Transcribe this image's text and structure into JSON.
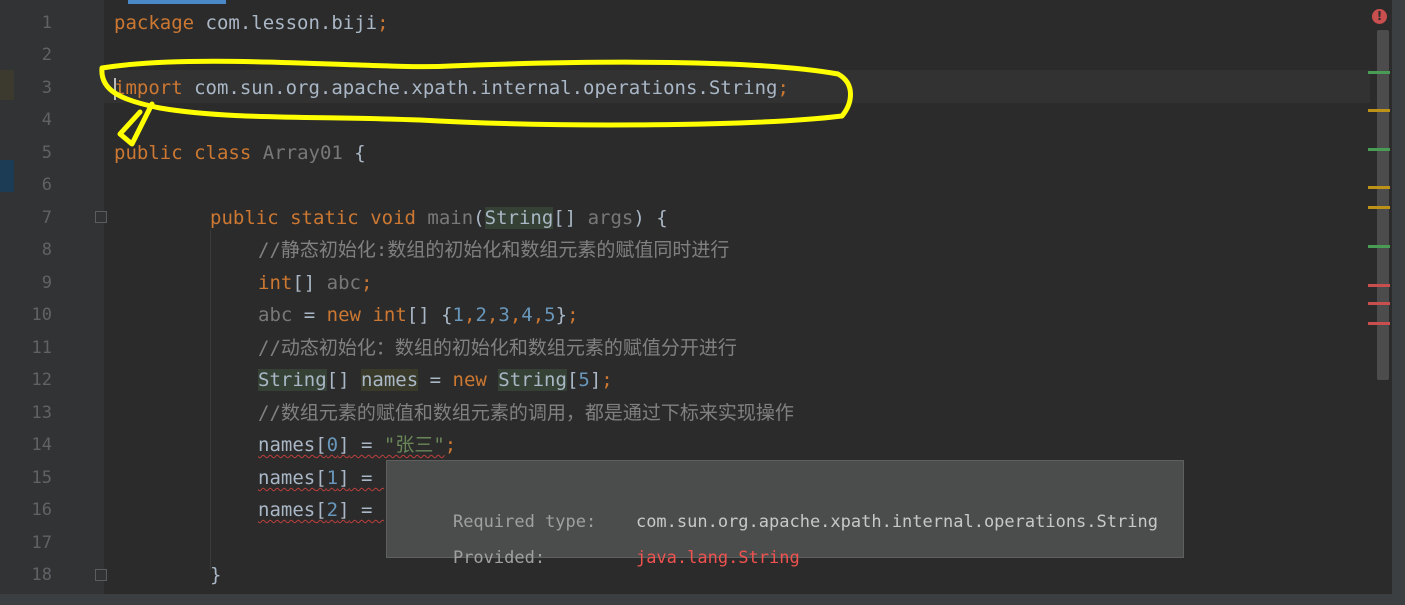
{
  "editor": {
    "lines": [
      {
        "n": "1",
        "text": "package com.lesson.biji;"
      },
      {
        "n": "2",
        "text": ""
      },
      {
        "n": "3",
        "text": "import com.sun.org.apache.xpath.internal.operations.String;"
      },
      {
        "n": "4",
        "text": ""
      },
      {
        "n": "5",
        "text": "public class Array01 {"
      },
      {
        "n": "6",
        "text": ""
      },
      {
        "n": "7",
        "text": "public static void main(String[] args) {"
      },
      {
        "n": "8",
        "text": "//静态初始化:数组的初始化和数组元素的赋值同时进行"
      },
      {
        "n": "9",
        "text": "int[] abc;"
      },
      {
        "n": "10",
        "text": "abc = new int[] {1,2,3,4,5};"
      },
      {
        "n": "11",
        "text": "//动态初始化：数组的初始化和数组元素的赋值分开进行"
      },
      {
        "n": "12",
        "text": "String[] names = new String[5];"
      },
      {
        "n": "13",
        "text": "//数组元素的赋值和数组元素的调用，都是通过下标来实现操作"
      },
      {
        "n": "14",
        "text": "names[0] = \"张三\";"
      },
      {
        "n": "15",
        "text": "names[1] ="
      },
      {
        "n": "16",
        "text": "names[2] ="
      },
      {
        "n": "17",
        "text": ""
      },
      {
        "n": "18",
        "text": "}"
      }
    ],
    "tokens": {
      "package_kw": "package",
      "package_name": " com.lesson.biji",
      "semi": ";",
      "import_kw": "import",
      "import_path": " com.sun.org.apache.xpath.internal.operations.String",
      "public": "public",
      "class": "class",
      "class_name": "Array01",
      "brace_open": " {",
      "static": "static",
      "void": "void",
      "main": "main",
      "paren_open": "(",
      "String": "String",
      "arr_br": "[]",
      "args": "args",
      "sig_end": ") {",
      "c8": "//静态初始化:数组的初始化和数组元素的赋值同时进行",
      "int": "int",
      "abc": "abc",
      "eq": " = ",
      "new": "new",
      "br_open": " {",
      "n1": "1",
      "n2": "2",
      "n3": "3",
      "n4": "4",
      "n5": "5",
      "comma": ",",
      "br_close": "}",
      "c11": "//动态初始化：数组的初始化和数组元素的赋值分开进行",
      "names": "names",
      "idx_open": "[",
      "idx_close": "]",
      "c13": "//数组元素的赋值和数组元素的调用，都是通过下标来实现操作",
      "str_zs": "\"张三\"",
      "i0": "0",
      "i1": "1",
      "i2": "2",
      "brace_close": "}"
    }
  },
  "tooltip": {
    "required_label": "Required type:",
    "required_value": "com.sun.org.apache.xpath.internal.operations.String",
    "provided_label": "Provided:",
    "provided_value": "java.lang.String"
  },
  "status": {
    "error_icon": "!",
    "colors": {
      "error": "#c94f4f",
      "warning": "#be9117",
      "ok": "#499c54",
      "annotation": "#ffff00"
    }
  }
}
